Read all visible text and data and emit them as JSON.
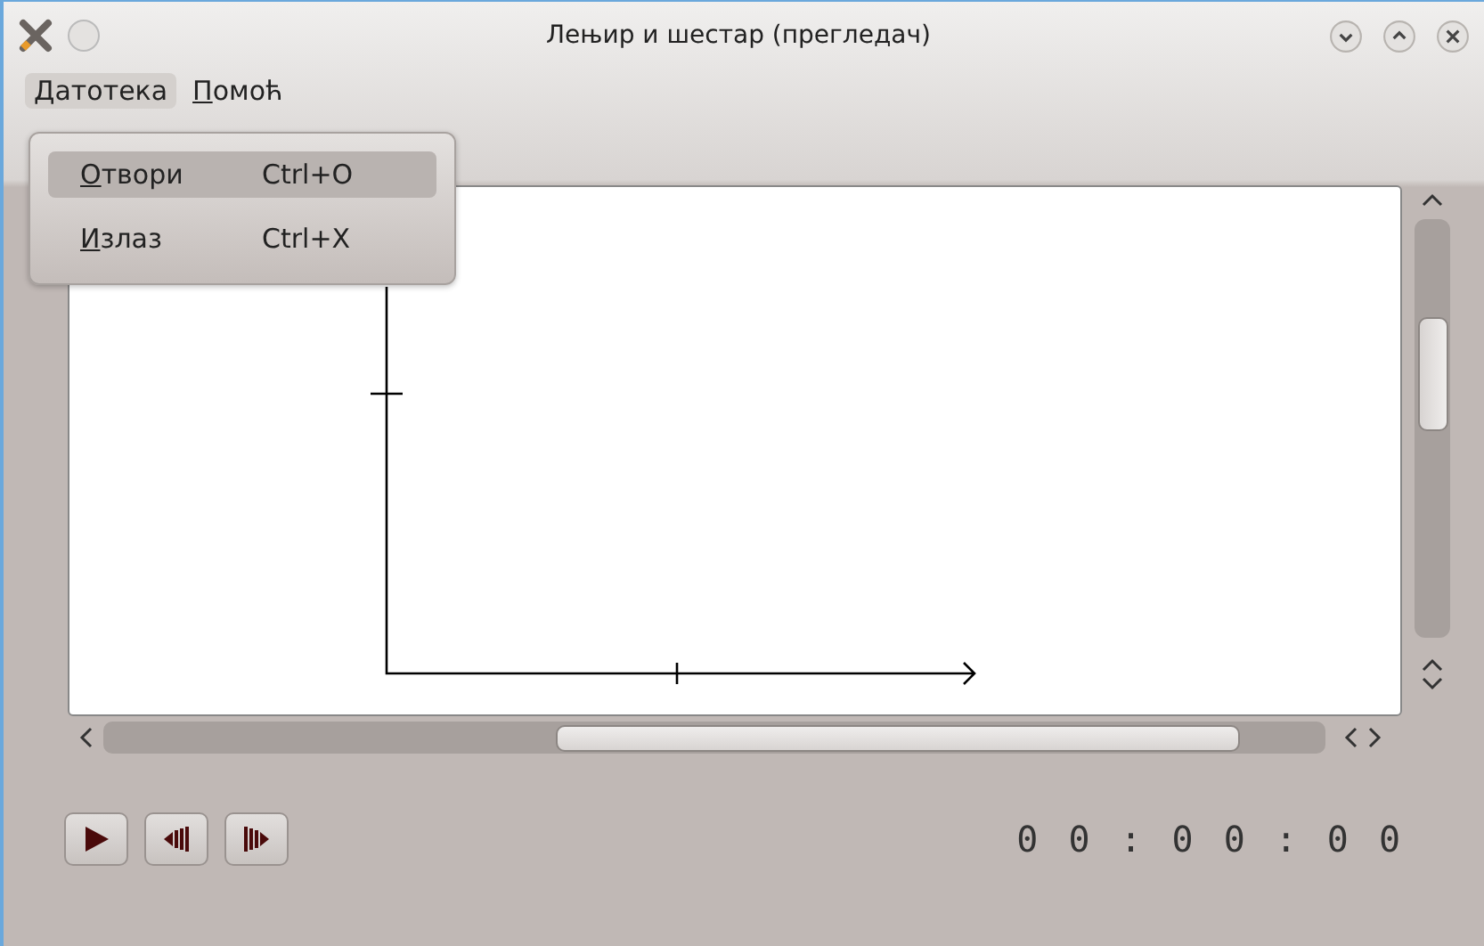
{
  "window": {
    "title": "Лењир и шестар (прегледач)"
  },
  "menubar": [
    {
      "label": "Датотека",
      "selected": true
    },
    {
      "label": "Помоћ",
      "selected": false
    }
  ],
  "menu": {
    "items": [
      {
        "label": "Отвори",
        "shortcut": "Ctrl+O",
        "selected": true
      },
      {
        "label": "Излаз",
        "shortcut": "Ctrl+X",
        "selected": false
      }
    ]
  },
  "player": {
    "buttons": [
      {
        "kind": "play"
      },
      {
        "kind": "step-back"
      },
      {
        "kind": "step-forward"
      }
    ],
    "time": "00:00:00"
  }
}
